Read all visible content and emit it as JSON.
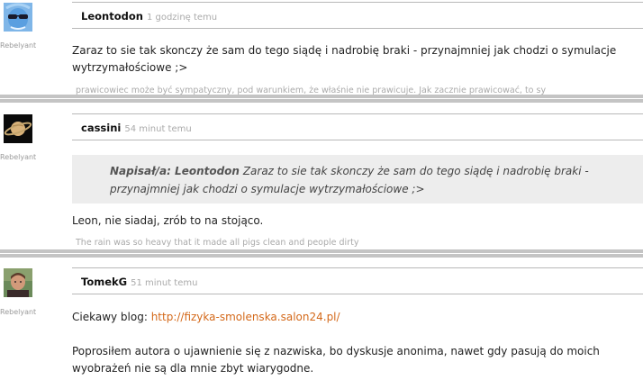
{
  "comments": [
    {
      "author": "Leontodon",
      "time": "1 godzinę temu",
      "rank": "Rebelyant",
      "avatar": "avatar-blue-sunglasses",
      "text": "Zaraz to sie tak skonczy że sam do tego siądę i nadrobię braki - przynajmniej jak chodzi o symulacje wytrzymałościowe ;>",
      "signature": "prawicowiec może być sympatyczny, pod warunkiem, że właśnie nie prawicuje. Jak zacznie prawicować, to sy"
    },
    {
      "author": "cassini",
      "time": "54 minut temu",
      "rank": "Rebelyant",
      "avatar": "avatar-saturn",
      "quote": {
        "prefix": "Napisał/a: Leontodon",
        "text": "Zaraz to sie tak skonczy że sam do tego siądę i nadrobię braki - przynajmniej jak chodzi o symulacje wytrzymałościowe ;>"
      },
      "text": "Leon, nie siadaj, zrób to na stojąco.",
      "signature": "The rain was so heavy that it made all pigs clean and people dirty"
    },
    {
      "author": "TomekG",
      "time": "51 minut temu",
      "rank": "Rebelyant",
      "avatar": "avatar-portrait",
      "text_prefix": "Ciekawy blog: ",
      "link": "http://fizyka-smolenska.salon24.pl/",
      "text2": "Poprosiłem autora o ujawnienie się z nazwiska, bo dyskusje anonima, nawet gdy pasują do moich wyobrażeń nie są dla mnie zbyt wiarygodne."
    }
  ],
  "colors": {
    "link": "#d4691a",
    "divider": "#c4c4c4",
    "quote_bg": "#ededed"
  }
}
